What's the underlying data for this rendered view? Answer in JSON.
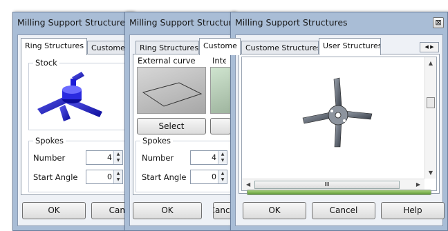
{
  "dialogs": [
    {
      "title": "Milling Support Structures",
      "tabs": [
        "Ring Structures",
        "Custome Structures"
      ],
      "stock_label": "Stock",
      "spokes_label": "Spokes",
      "number_label": "Number",
      "number_value": "4",
      "start_angle_label": "Start Angle",
      "start_angle_value": "0",
      "ok_label": "OK",
      "cancel_label": "Cancel"
    },
    {
      "title": "Milling Support Structures",
      "tabs": [
        "Ring Structures",
        "Custome Structures"
      ],
      "external_curve_label": "External curve",
      "internal_curve_label": "Internal curve",
      "select_label": "Select",
      "spokes_label": "Spokes",
      "number_label": "Number",
      "number_value": "4",
      "start_angle_label": "Start Angle",
      "start_angle_value": "0",
      "ok_label": "OK",
      "cancel_label": "Cancel"
    },
    {
      "title": "Milling Support Structures",
      "close_glyph": "⊠",
      "tabs": [
        "Custome Structures",
        "User Structures"
      ],
      "scroll_hbar_grip": "III",
      "ok_label": "OK",
      "cancel_label": "Cancel",
      "help_label": "Help",
      "progress_fraction": 1.0
    }
  ],
  "colors": {
    "stock_blue": "#1b1bd6",
    "progress_green": "#7bb44a",
    "title_bar": "#a9bdd6"
  }
}
